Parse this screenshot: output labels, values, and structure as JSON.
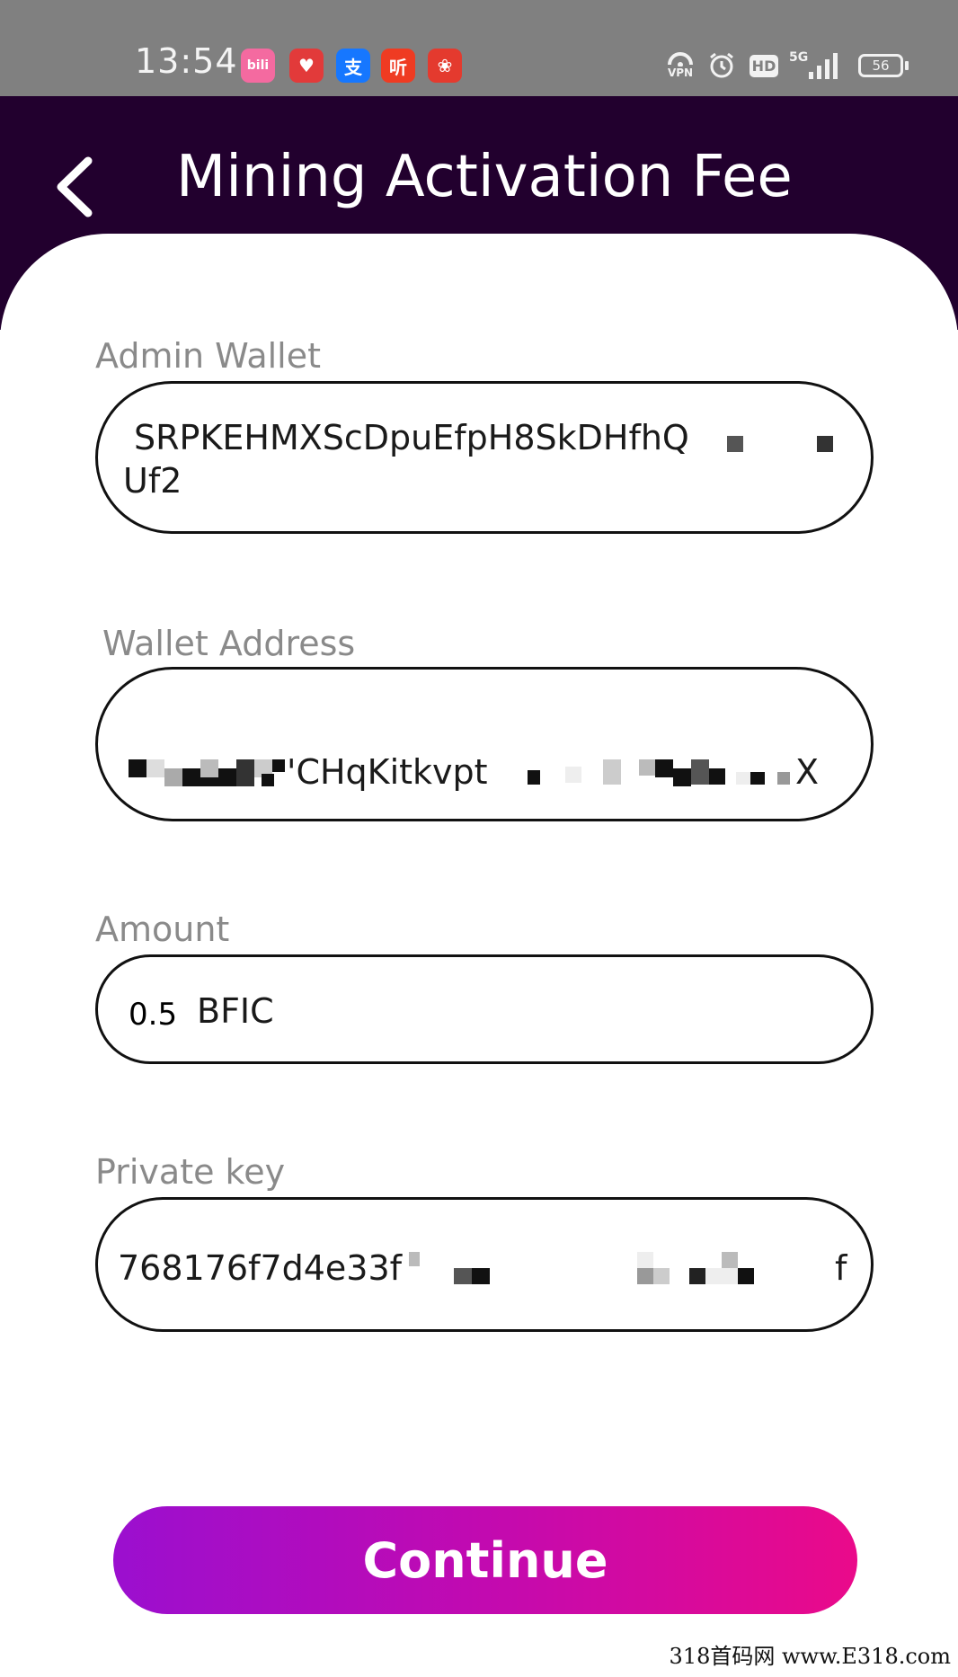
{
  "status_bar": {
    "time": "13:54",
    "apps": [
      {
        "icon": "bilibili-app-icon",
        "glyph": "bili",
        "color": "#f46aa0"
      },
      {
        "icon": "heart-app-icon",
        "glyph": "♥",
        "color": "#e23a3a"
      },
      {
        "icon": "alipay-app-icon",
        "glyph": "支",
        "color": "#1677ff"
      },
      {
        "icon": "listen-app-icon",
        "glyph": "听",
        "color": "#ef3b22"
      },
      {
        "icon": "flower-app-icon",
        "glyph": "❀",
        "color": "#e43a2e"
      }
    ],
    "vpn_label": "VPN",
    "hd_label": "HD",
    "network_label": "5G",
    "battery": "56"
  },
  "header": {
    "back_icon": "chevron-left-icon",
    "title": "Mining Activation Fee"
  },
  "form": {
    "admin_wallet": {
      "label": "Admin Wallet",
      "line1": "SRPKEHMXScDpuEfpH8SkDHfhQ",
      "line2": "Uf2"
    },
    "wallet_address": {
      "label": "Wallet Address",
      "visible_part": "'CHqKitkvpt",
      "end": "X"
    },
    "amount": {
      "label": "Amount",
      "value": "0.5",
      "unit": "BFIC"
    },
    "private_key": {
      "label": "Private key",
      "start": "768176f7d4e33f",
      "end": "f"
    }
  },
  "continue_button": {
    "label": "Continue"
  },
  "watermark": "318首码网 www.E318.com",
  "colors": {
    "header_bg": "#22002e",
    "button_gradient_start": "#9b0fcf",
    "button_gradient_end": "#ea0a8a",
    "label_color": "#8a8a8a"
  }
}
